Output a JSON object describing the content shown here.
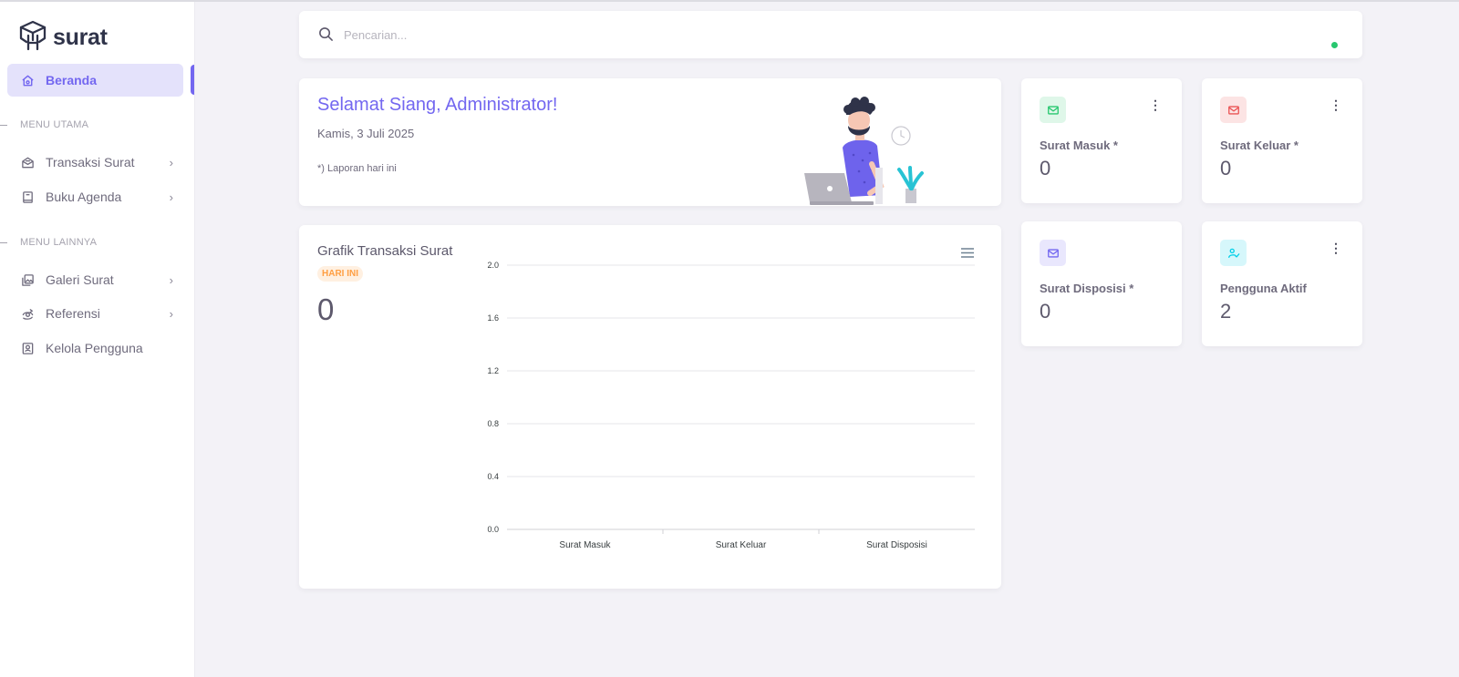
{
  "brand": {
    "name": "surat"
  },
  "sidebar": {
    "active": {
      "label": "Beranda",
      "icon": "home-icon"
    },
    "sections": [
      {
        "header": "MENU UTAMA",
        "items": [
          {
            "label": "Transaksi Surat",
            "icon": "mail-opened-icon"
          },
          {
            "label": "Buku Agenda",
            "icon": "book-icon"
          }
        ]
      },
      {
        "header": "MENU LAINNYA",
        "items": [
          {
            "label": "Galeri Surat",
            "icon": "photo-gallery-icon"
          },
          {
            "label": "Referensi",
            "icon": "eye-refresh-icon"
          },
          {
            "label": "Kelola Pengguna",
            "icon": "user-box-icon"
          }
        ]
      }
    ]
  },
  "search": {
    "placeholder": "Pencarian...",
    "value": ""
  },
  "greeting": {
    "title": "Selamat Siang, Administrator!",
    "date": "Kamis, 3 Juli 2025",
    "note": "*) Laporan hari ini"
  },
  "stats": [
    {
      "label": "Surat Masuk *",
      "value": "0",
      "icon": "mail-icon",
      "color": "#28c76f",
      "bg": "#dff7e9"
    },
    {
      "label": "Surat Keluar *",
      "value": "0",
      "icon": "mail-icon",
      "color": "#ea5455",
      "bg": "#fce4e4"
    },
    {
      "label": "Surat Disposisi *",
      "value": "0",
      "icon": "mail-icon",
      "color": "#7367f0",
      "bg": "#e9e7fd"
    },
    {
      "label": "Pengguna Aktif",
      "value": "2",
      "icon": "user-check-icon",
      "color": "#00cfe8",
      "bg": "#d6f7fb"
    }
  ],
  "chart": {
    "title": "Grafik Transaksi Surat",
    "badge": "HARI INI",
    "total": "0"
  },
  "chart_data": {
    "type": "bar",
    "categories": [
      "Surat Masuk",
      "Surat Keluar",
      "Surat Disposisi"
    ],
    "values": [
      0,
      0,
      0
    ],
    "title": "Grafik Transaksi Surat",
    "xlabel": "",
    "ylabel": "",
    "ylim": [
      0,
      2.0
    ],
    "yticks": [
      "0.0",
      "0.4",
      "0.8",
      "1.2",
      "1.6",
      "2.0"
    ],
    "grid": true
  },
  "colors": {
    "accent": "#7367f0",
    "online": "#28c76f"
  }
}
